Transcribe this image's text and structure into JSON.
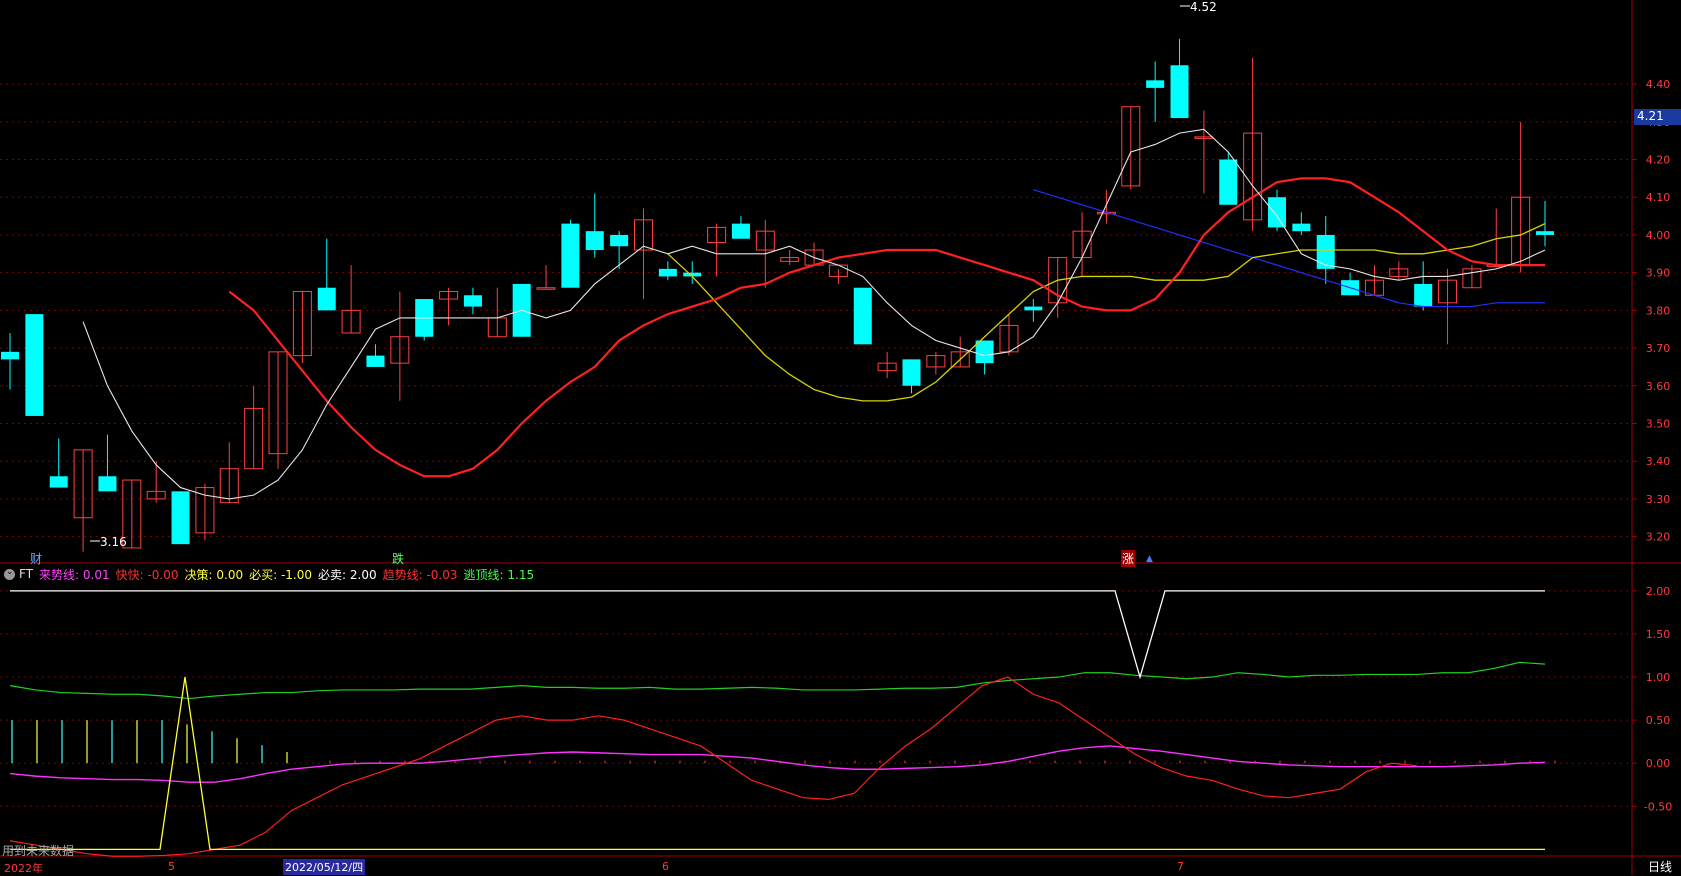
{
  "colors": {
    "background": "#000000",
    "grid": "#7a0000",
    "bull": "#ff4040",
    "bear": "#00ffff",
    "ma5": "#e6e6e6",
    "ma10": "#ff2020",
    "ma20": "#d4d400",
    "ma60": "#2030ff",
    "axis_text": "#ff3a3a",
    "price_tag_bg": "#1a3aa0"
  },
  "price_axis": {
    "ticks": [
      "4.40",
      "4.30",
      "4.20",
      "4.10",
      "4.00",
      "3.90",
      "3.80",
      "3.70",
      "3.60",
      "3.50",
      "3.40",
      "3.30",
      "3.20"
    ],
    "current_price": "4.21",
    "range": [
      3.13,
      4.57
    ]
  },
  "annotations": {
    "high": "4.52",
    "low": "3.16",
    "marker_cai": "财",
    "marker_die": "跌",
    "marker_zhang": "涨"
  },
  "indicator": {
    "name": "FT",
    "legend": [
      {
        "key": "来势线",
        "value": "0.01",
        "color": "#ff40ff"
      },
      {
        "key": "快快",
        "value": "-0.00",
        "color": "#ff3030"
      },
      {
        "key": "决策",
        "value": "0.00",
        "color": "#ffff40"
      },
      {
        "key": "必买",
        "value": "-1.00",
        "color": "#ffff40"
      },
      {
        "key": "必卖",
        "value": "2.00",
        "color": "#ffffff"
      },
      {
        "key": "趋势线",
        "value": "-0.03",
        "color": "#ff3030"
      },
      {
        "key": "逃顶线",
        "value": "1.15",
        "color": "#40ff40"
      }
    ],
    "axis_ticks": [
      "2.00",
      "1.50",
      "1.00",
      "0.50",
      "0.00",
      "-0.50"
    ],
    "range": [
      -1.1,
      2.3
    ]
  },
  "bottom_bar": {
    "future_note": "用到未来数据",
    "dates": [
      "2022年",
      "5",
      "2022/05/12/四",
      "6",
      "7"
    ],
    "period": "日线"
  },
  "chart_data": {
    "type": "candlestick",
    "candles": [
      [
        3.69,
        3.67,
        3.74,
        3.59
      ],
      [
        3.79,
        3.52,
        3.79,
        3.52
      ],
      [
        3.36,
        3.33,
        3.46,
        3.33
      ],
      [
        3.25,
        3.43,
        3.43,
        3.16
      ],
      [
        3.36,
        3.32,
        3.47,
        3.32
      ],
      [
        3.17,
        3.35,
        3.35,
        3.17
      ],
      [
        3.3,
        3.32,
        3.4,
        3.29
      ],
      [
        3.32,
        3.18,
        3.32,
        3.18
      ],
      [
        3.21,
        3.33,
        3.34,
        3.19
      ],
      [
        3.29,
        3.38,
        3.45,
        3.29
      ],
      [
        3.38,
        3.54,
        3.6,
        3.38
      ],
      [
        3.42,
        3.69,
        3.69,
        3.38
      ],
      [
        3.68,
        3.85,
        3.85,
        3.66
      ],
      [
        3.86,
        3.8,
        3.99,
        3.8
      ],
      [
        3.74,
        3.8,
        3.92,
        3.74
      ],
      [
        3.68,
        3.65,
        3.71,
        3.65
      ],
      [
        3.66,
        3.73,
        3.85,
        3.56
      ],
      [
        3.83,
        3.73,
        3.83,
        3.72
      ],
      [
        3.83,
        3.85,
        3.86,
        3.76
      ],
      [
        3.84,
        3.81,
        3.86,
        3.79
      ],
      [
        3.73,
        3.78,
        3.86,
        3.73
      ],
      [
        3.87,
        3.73,
        3.87,
        3.73
      ],
      [
        3.86,
        3.86,
        3.92,
        3.86
      ],
      [
        4.03,
        3.86,
        4.04,
        3.86
      ],
      [
        4.01,
        3.96,
        4.11,
        3.94
      ],
      [
        4.0,
        3.97,
        4.01,
        3.91
      ],
      [
        3.96,
        4.04,
        4.07,
        3.83
      ],
      [
        3.91,
        3.89,
        3.93,
        3.88
      ],
      [
        3.9,
        3.89,
        3.93,
        3.87
      ],
      [
        3.98,
        4.02,
        4.03,
        3.89
      ],
      [
        4.03,
        3.99,
        4.05,
        3.99
      ],
      [
        3.96,
        4.01,
        4.04,
        3.86
      ],
      [
        3.93,
        3.94,
        3.96,
        3.92
      ],
      [
        3.92,
        3.96,
        3.98,
        3.92
      ],
      [
        3.89,
        3.92,
        3.91,
        3.87
      ],
      [
        3.86,
        3.71,
        3.86,
        3.71
      ],
      [
        3.64,
        3.66,
        3.69,
        3.62
      ],
      [
        3.67,
        3.6,
        3.67,
        3.58
      ],
      [
        3.65,
        3.68,
        3.69,
        3.63
      ],
      [
        3.65,
        3.69,
        3.73,
        3.65
      ],
      [
        3.72,
        3.66,
        3.72,
        3.63
      ],
      [
        3.69,
        3.76,
        3.79,
        3.68
      ],
      [
        3.81,
        3.8,
        3.83,
        3.77
      ],
      [
        3.82,
        3.94,
        3.94,
        3.78
      ],
      [
        3.94,
        4.01,
        4.06,
        3.89
      ],
      [
        4.06,
        4.06,
        4.12,
        4.03
      ],
      [
        4.13,
        4.34,
        4.34,
        4.12
      ],
      [
        4.41,
        4.39,
        4.46,
        4.3
      ],
      [
        4.45,
        4.31,
        4.52,
        4.31
      ],
      [
        4.26,
        4.26,
        4.33,
        4.11
      ],
      [
        4.2,
        4.08,
        4.22,
        4.08
      ],
      [
        4.04,
        4.27,
        4.47,
        4.01
      ],
      [
        4.1,
        4.02,
        4.12,
        4.01
      ],
      [
        4.03,
        4.01,
        4.06,
        4.0
      ],
      [
        4.0,
        3.91,
        4.05,
        3.87
      ],
      [
        3.88,
        3.84,
        3.9,
        3.84
      ],
      [
        3.84,
        3.88,
        3.92,
        3.84
      ],
      [
        3.89,
        3.91,
        3.93,
        3.88
      ],
      [
        3.87,
        3.81,
        3.93,
        3.8
      ],
      [
        3.82,
        3.88,
        3.91,
        3.71
      ],
      [
        3.86,
        3.91,
        3.92,
        3.86
      ],
      [
        3.92,
        3.92,
        4.07,
        3.92
      ],
      [
        3.92,
        4.1,
        4.3,
        3.9
      ],
      [
        4.01,
        4.0,
        4.09,
        3.97
      ]
    ],
    "ma5": [
      3.77,
      3.6,
      3.48,
      3.39,
      3.33,
      3.31,
      3.3,
      3.31,
      3.35,
      3.43,
      3.55,
      3.65,
      3.75,
      3.78,
      3.78,
      3.78,
      3.78,
      3.78,
      3.8,
      3.78,
      3.8,
      3.87,
      3.92,
      3.97,
      3.95,
      3.97,
      3.95,
      3.95,
      3.95,
      3.97,
      3.94,
      3.92,
      3.89,
      3.82,
      3.76,
      3.72,
      3.7,
      3.68,
      3.69,
      3.73,
      3.82,
      3.94,
      4.08,
      4.22,
      4.24,
      4.27,
      4.28,
      4.22,
      4.13,
      4.05,
      3.95,
      3.92,
      3.91,
      3.89,
      3.88,
      3.89,
      3.89,
      3.9,
      3.91,
      3.93,
      3.96
    ],
    "ma10": [
      3.85,
      3.8,
      3.72,
      3.64,
      3.56,
      3.49,
      3.43,
      3.39,
      3.36,
      3.36,
      3.38,
      3.43,
      3.5,
      3.56,
      3.61,
      3.65,
      3.72,
      3.76,
      3.79,
      3.81,
      3.83,
      3.86,
      3.87,
      3.9,
      3.92,
      3.94,
      3.95,
      3.96,
      3.96,
      3.96,
      3.94,
      3.92,
      3.9,
      3.88,
      3.84,
      3.81,
      3.8,
      3.8,
      3.83,
      3.9,
      4.0,
      4.06,
      4.1,
      4.14,
      4.15,
      4.15,
      4.14,
      4.1,
      4.06,
      4.01,
      3.96,
      3.93,
      3.92,
      3.92,
      3.92
    ],
    "ma20": [
      3.95,
      3.89,
      3.82,
      3.75,
      3.68,
      3.63,
      3.59,
      3.57,
      3.56,
      3.56,
      3.57,
      3.61,
      3.67,
      3.73,
      3.79,
      3.85,
      3.88,
      3.89,
      3.89,
      3.89,
      3.88,
      3.88,
      3.88,
      3.89,
      3.94,
      3.95,
      3.96,
      3.96,
      3.96,
      3.96,
      3.95,
      3.95,
      3.96,
      3.97,
      3.99,
      4.0,
      4.03
    ],
    "ma60": [
      4.12,
      4.1,
      4.08,
      4.06,
      4.04,
      4.02,
      4.0,
      3.98,
      3.96,
      3.94,
      3.92,
      3.9,
      3.88,
      3.86,
      3.84,
      3.82,
      3.81,
      3.81,
      3.81,
      3.82,
      3.82,
      3.82
    ]
  }
}
